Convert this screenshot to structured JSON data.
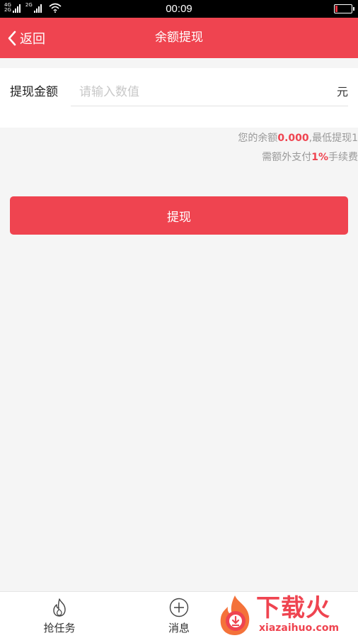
{
  "status_bar": {
    "network_1": "4G",
    "network_1b": "2G",
    "network_2": "2G",
    "time": "00:09",
    "battery_level": 0.15
  },
  "header": {
    "back_label": "返回",
    "title": "余额提现"
  },
  "form": {
    "amount_label": "提现金额",
    "amount_placeholder": "请输入数值",
    "amount_value": "",
    "unit": "元"
  },
  "info": {
    "line1_prefix": "您的余额",
    "balance": "0.000",
    "line1_suffix": ",最低提现1",
    "line2_prefix": "需额外支付",
    "fee_rate": "1%",
    "line2_suffix": "手续费"
  },
  "submit_label": "提现",
  "bottom_nav": {
    "items": [
      {
        "label": "抢任务",
        "icon": "flame-icon"
      },
      {
        "label": "消息",
        "icon": "plus-circle-icon"
      }
    ]
  },
  "watermark": {
    "text_cn": "下载火",
    "text_en": "xiazaihuo.com"
  },
  "colors": {
    "accent": "#ef4450",
    "background": "#f5f5f5",
    "placeholder": "#c8c8c8",
    "hint_text": "#999999"
  }
}
